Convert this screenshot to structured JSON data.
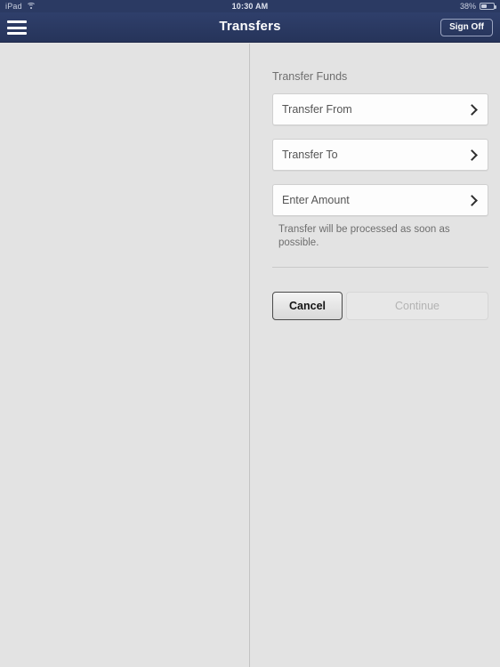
{
  "status_bar": {
    "device": "iPad",
    "wifi_icon": "wifi-icon",
    "time": "10:30 AM",
    "battery_percent": "38%",
    "battery_icon": "battery-icon"
  },
  "nav_bar": {
    "menu_icon": "hamburger-menu-icon",
    "title": "Transfers",
    "sign_off_label": "Sign Off"
  },
  "main": {
    "section_title": "Transfer Funds",
    "fields": [
      {
        "label": "Transfer From",
        "chevron": "chevron-right-icon"
      },
      {
        "label": "Transfer To",
        "chevron": "chevron-right-icon"
      },
      {
        "label": "Enter Amount",
        "chevron": "chevron-right-icon"
      }
    ],
    "helper_text": "Transfer will be processed as soon as possible.",
    "buttons": {
      "cancel_label": "Cancel",
      "continue_label": "Continue"
    }
  },
  "colors": {
    "nav_background": "#2b3a63",
    "page_background": "#e3e3e3",
    "field_background": "#fdfdfd",
    "text_primary": "#555555",
    "text_muted": "#6e6e6e"
  }
}
